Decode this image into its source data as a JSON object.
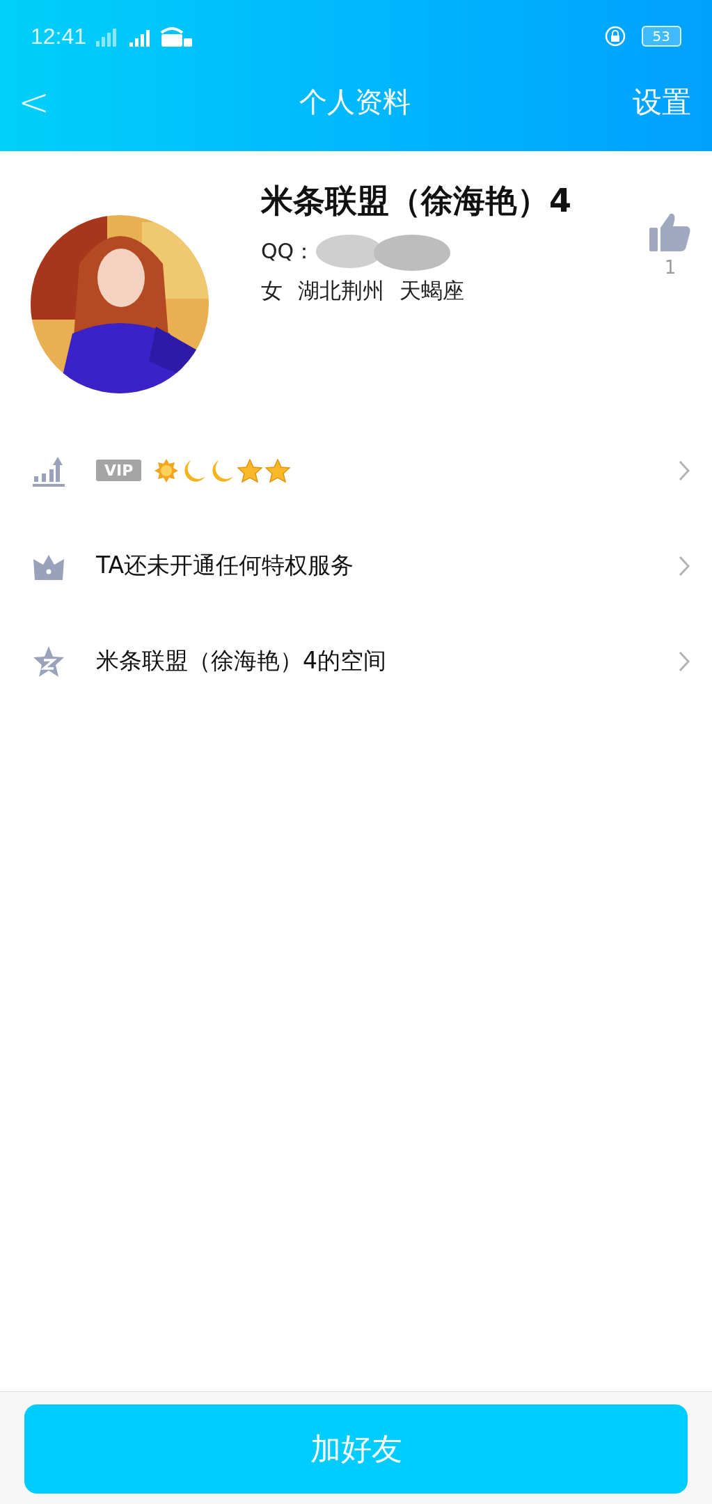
{
  "status_bar": {
    "time": "12:41",
    "battery": "53"
  },
  "nav": {
    "back": "<",
    "title": "个人资料",
    "action": "设置"
  },
  "profile": {
    "name": "米条联盟（徐海艳）4",
    "likes": "1",
    "qq_label": "QQ：",
    "gender": "女",
    "location": "湖北荆州",
    "zodiac": "天蝎座"
  },
  "rows": [
    {
      "kind": "level",
      "badge": "VIP",
      "level_icons": [
        {
          "kind": "sun"
        },
        {
          "kind": "moon"
        },
        {
          "kind": "moon"
        },
        {
          "kind": "star"
        },
        {
          "kind": "star"
        }
      ]
    },
    {
      "kind": "text",
      "label": "TA还未开通任何特权服务"
    },
    {
      "kind": "text",
      "label": "米条联盟（徐海艳）4的空间"
    }
  ],
  "add_friend_button": "加好友"
}
